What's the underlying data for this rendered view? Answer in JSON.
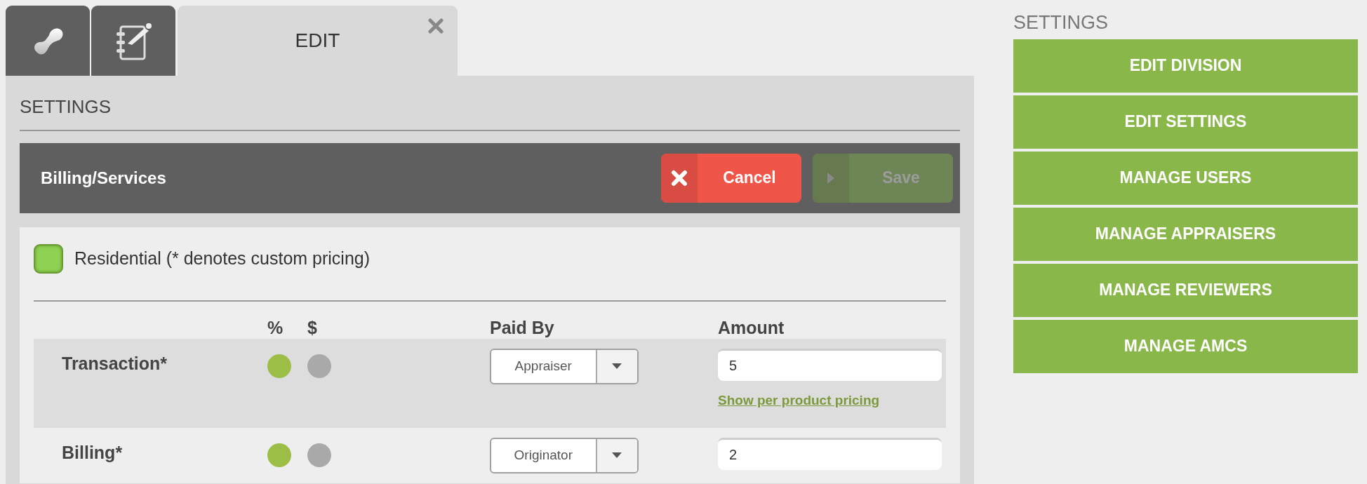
{
  "tabs": [
    {
      "kind": "icon",
      "selected": false
    },
    {
      "kind": "icon",
      "selected": false
    },
    {
      "kind": "text",
      "label": "EDIT",
      "selected": true,
      "closable": true
    }
  ],
  "section_title": "SETTINGS",
  "panel": {
    "title": "Billing/Services",
    "buttons": [
      {
        "kind": "cancel",
        "label": "Cancel",
        "disabled": false
      },
      {
        "kind": "save",
        "label": "Save",
        "disabled": true
      }
    ]
  },
  "group": {
    "label": "Residential (* denotes custom pricing)",
    "checked": true
  },
  "columns": [
    "%",
    "$",
    "Paid By",
    "Amount"
  ],
  "rows": [
    {
      "label": "Transaction*",
      "options": [
        {
          "selected": true
        },
        {
          "selected": false
        }
      ],
      "paid_by": "Appraiser",
      "amount": "5",
      "link": "Show per product pricing"
    },
    {
      "label": "Billing*",
      "options": [
        {
          "selected": true
        },
        {
          "selected": false
        }
      ],
      "paid_by": "Originator",
      "amount": "2"
    }
  ],
  "sidebar": {
    "title": "SETTINGS",
    "items": [
      "EDIT DIVISION",
      "EDIT SETTINGS",
      "MANAGE USERS",
      "MANAGE APPRAISERS",
      "MANAGE REVIEWERS",
      "MANAGE AMCS"
    ]
  }
}
